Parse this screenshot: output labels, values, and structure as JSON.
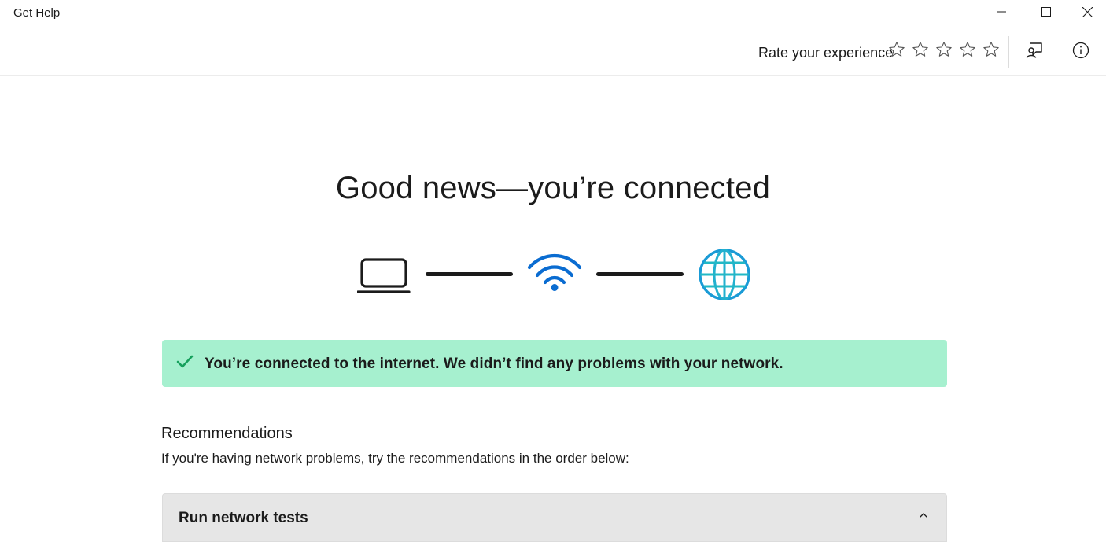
{
  "titlebar": {
    "app_title": "Get Help",
    "minimize_icon": "minimize-icon",
    "maximize_icon": "maximize-icon",
    "close_icon": "close-icon"
  },
  "header": {
    "rate_label": "Rate your experience",
    "stars_total": 5,
    "stars_selected": 0,
    "feedback_icon": "feedback-icon",
    "info_icon": "info-icon"
  },
  "main": {
    "headline": "Good news—you’re connected",
    "diagram": {
      "icons": [
        "laptop-icon",
        "wifi-icon",
        "globe-icon"
      ],
      "colors": {
        "wifi": "#0a6cd1",
        "globe": "#1a9bd6",
        "globe_grid": "#22c0c0",
        "line": "#1b1b1b"
      }
    },
    "banner": {
      "text": "You’re connected to the internet. We didn’t find any problems with your network.",
      "icon": "checkmark-icon",
      "background": "#a6f0cf",
      "check_color": "#15a05c"
    },
    "recommendations": {
      "title": "Recommendations",
      "subtitle": "If you're having network problems, try the recommendations in the order below:"
    },
    "expander": {
      "label": "Run network tests",
      "icon": "chevron-up-icon",
      "expanded": true
    }
  }
}
